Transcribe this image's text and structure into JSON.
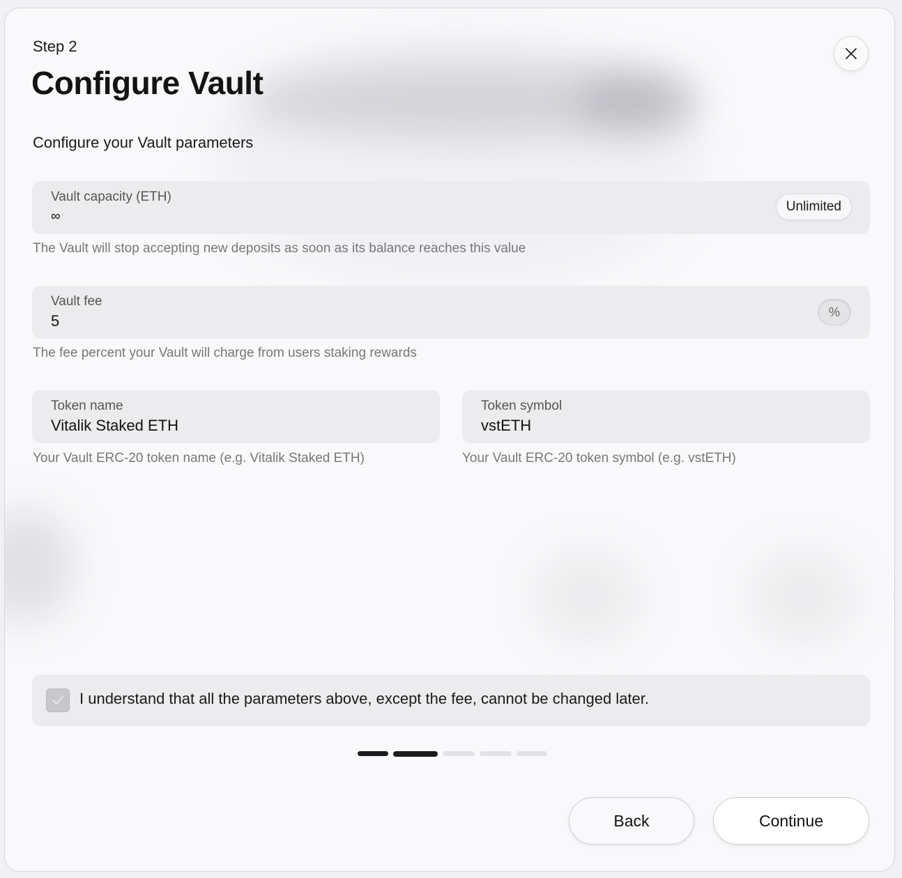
{
  "modal": {
    "step_label": "Step 2",
    "title": "Configure Vault",
    "subtitle": "Configure your Vault parameters",
    "close_icon": "close-icon"
  },
  "fields": {
    "capacity": {
      "label": "Vault capacity (ETH)",
      "value": "∞",
      "toggle_label": "Unlimited",
      "helper": "The Vault will stop accepting new deposits as soon as its balance reaches this value"
    },
    "fee": {
      "label": "Vault fee",
      "value": "5",
      "unit": "%",
      "helper": "The fee percent your Vault will charge from users staking rewards"
    },
    "token_name": {
      "label": "Token name",
      "value": "Vitalik Staked ETH",
      "helper": "Your Vault ERC-20 token name (e.g. Vitalik Staked ETH)"
    },
    "token_symbol": {
      "label": "Token symbol",
      "value": "vstETH",
      "helper": "Your Vault ERC-20 token symbol (e.g. vstETH)"
    }
  },
  "agreement": {
    "checked": true,
    "text": "I understand that all the parameters above, except the fee, cannot be changed later."
  },
  "progress": {
    "total_steps": 5,
    "current_step": 2
  },
  "buttons": {
    "back": "Back",
    "continue": "Continue"
  },
  "colors": {
    "active_segment": "#1c1c1e",
    "inactive_segment": "#e3e3e7",
    "field_background": "#ececef"
  }
}
